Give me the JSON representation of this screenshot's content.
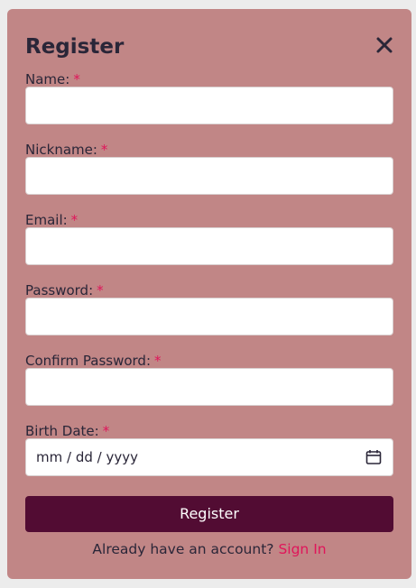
{
  "modal": {
    "title": "Register",
    "required_marker": "*"
  },
  "fields": {
    "name": {
      "label": "Name:",
      "value": ""
    },
    "nickname": {
      "label": "Nickname:",
      "value": ""
    },
    "email": {
      "label": "Email:",
      "value": ""
    },
    "password": {
      "label": "Password:",
      "value": ""
    },
    "confirm_password": {
      "label": "Confirm Password:",
      "value": ""
    },
    "birth_date": {
      "label": "Birth Date:",
      "placeholder": "mm / dd / yyyy"
    }
  },
  "submit": {
    "label": "Register"
  },
  "footer": {
    "prompt": "Already have an account?",
    "link": "Sign In"
  },
  "icons": {
    "close": "close-icon",
    "calendar": "calendar-icon"
  },
  "colors": {
    "modal_bg": "#c18686",
    "button_bg": "#520c33",
    "accent": "#e0155a",
    "text": "#2a2638"
  }
}
